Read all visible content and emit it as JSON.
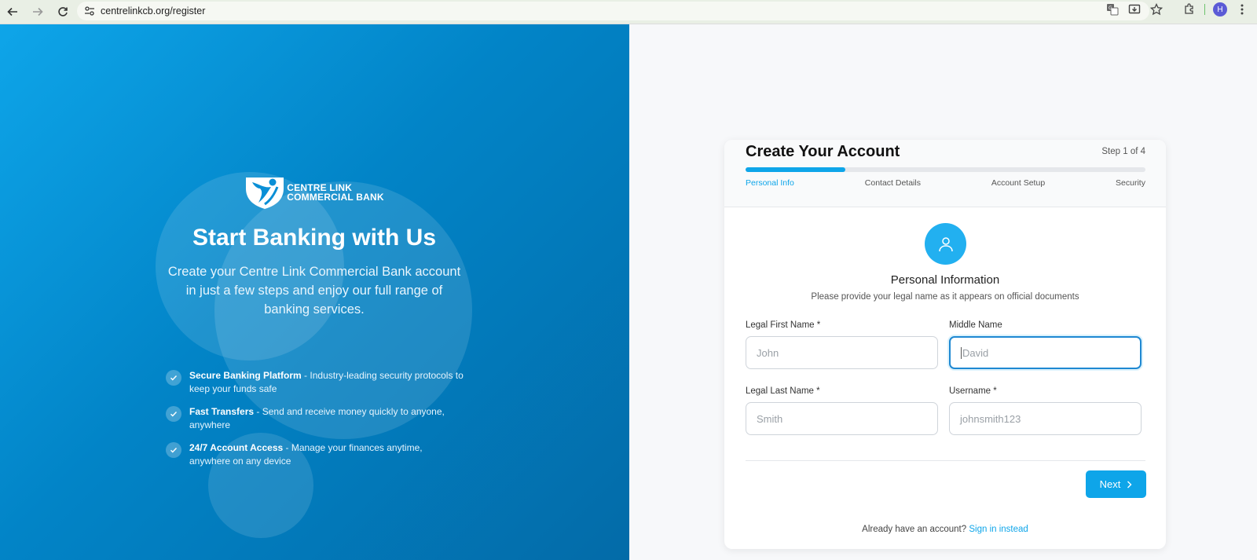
{
  "browser": {
    "url": "centrelinkcb.org/register",
    "profile_initial": "H",
    "icons": [
      "back-arrow-icon",
      "forward-arrow-icon",
      "reload-icon",
      "site-info-icon",
      "translate-icon",
      "install-icon",
      "bookmark-star-icon",
      "extensions-icon",
      "menu-dots-icon"
    ]
  },
  "hero": {
    "logo_line1": "CENTRE LINK",
    "logo_line2": "COMMERCIAL BANK",
    "title": "Start Banking with Us",
    "subtitle": "Create your Centre Link Commercial Bank account in just a few steps and enjoy our full range of banking services.",
    "features": [
      {
        "title": "Secure Banking Platform",
        "text": " - Industry-leading security protocols to keep your funds safe"
      },
      {
        "title": "Fast Transfers",
        "text": " - Send and receive money quickly to anyone, anywhere"
      },
      {
        "title": "24/7 Account Access",
        "text": " - Manage your finances anytime, anywhere on any device"
      }
    ]
  },
  "card": {
    "title": "Create Your Account",
    "step_count": "Step 1 of 4",
    "progress": 0.25,
    "steps": [
      "Personal Info",
      "Contact Details",
      "Account Setup",
      "Security"
    ],
    "section_title": "Personal Information",
    "section_subtitle": "Please provide your legal name as it appears on official documents",
    "fields": {
      "first_name": {
        "label": "Legal First Name *",
        "placeholder": "John"
      },
      "middle_name": {
        "label": "Middle Name",
        "placeholder": "David"
      },
      "last_name": {
        "label": "Legal Last Name *",
        "placeholder": "Smith"
      },
      "username": {
        "label": "Username *",
        "placeholder": "johnsmith123"
      }
    },
    "next_label": "Next",
    "signin_prompt": "Already have an account?",
    "signin_link": "Sign in instead"
  },
  "colors": {
    "accent": "#0ea5e9",
    "hero_dark": "#036ba8",
    "focus_border": "#1e88d2"
  }
}
